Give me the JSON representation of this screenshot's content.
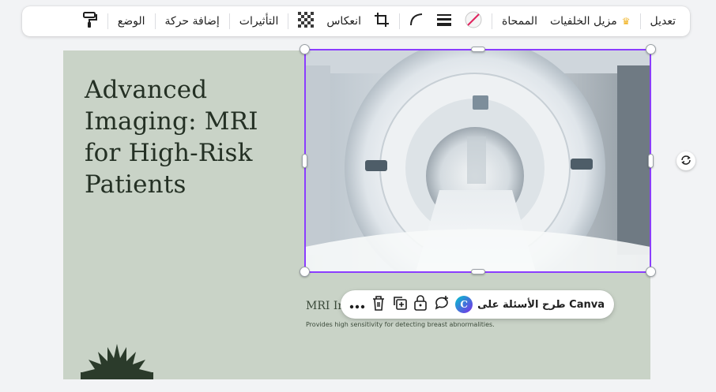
{
  "toolbar": {
    "edit": "تعديل",
    "bg_remover": "مزيل الخلفيات",
    "eraser": "الممحاة",
    "flip": "انعكاس",
    "effects": "التأثيرات",
    "add_animation": "إضافة حركة",
    "position": "الوضع"
  },
  "design": {
    "title": "Advanced Imaging: MRI for High-Risk Patients",
    "caption_title": "MRI In",
    "caption_desc": "Provides high sensitivity for detecting breast abnormalities."
  },
  "context_toolbar": {
    "ask_canva": "طرح الأسئلة على Canva",
    "canva_logo_letter": "C"
  },
  "colors": {
    "accent": "#8b3dff",
    "canvas_bg": "#c9d3c7",
    "text_dark": "#243024",
    "crown": "#f1b322"
  }
}
